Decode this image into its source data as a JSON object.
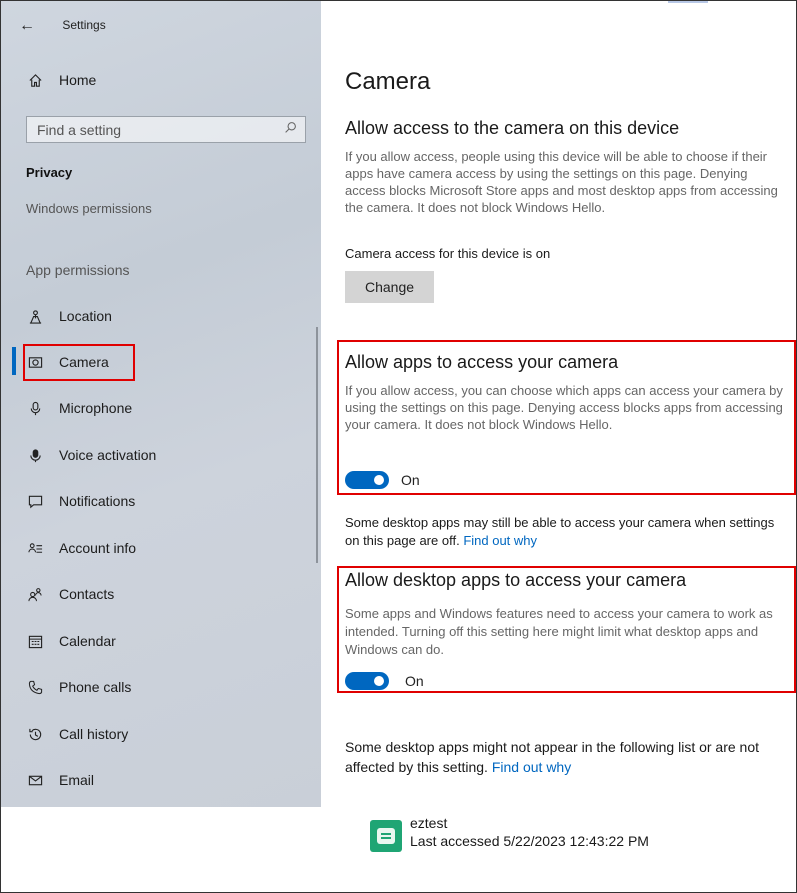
{
  "window": {
    "title": "Settings"
  },
  "sidebar": {
    "home_label": "Home",
    "search_placeholder": "Find a setting",
    "section": "Privacy",
    "faded_item": "Windows permissions",
    "group_label": "App permissions",
    "items": [
      {
        "label": "Location",
        "icon": "location-icon"
      },
      {
        "label": "Camera",
        "icon": "camera-icon",
        "selected": true
      },
      {
        "label": "Microphone",
        "icon": "microphone-icon"
      },
      {
        "label": "Voice activation",
        "icon": "voice-activation-icon"
      },
      {
        "label": "Notifications",
        "icon": "notifications-icon"
      },
      {
        "label": "Account info",
        "icon": "account-info-icon"
      },
      {
        "label": "Contacts",
        "icon": "contacts-icon"
      },
      {
        "label": "Calendar",
        "icon": "calendar-icon"
      },
      {
        "label": "Phone calls",
        "icon": "phone-icon"
      },
      {
        "label": "Call history",
        "icon": "history-icon"
      },
      {
        "label": "Email",
        "icon": "email-icon"
      }
    ]
  },
  "main": {
    "page_title": "Camera",
    "device_section": {
      "heading": "Allow access to the camera on this device",
      "description": "If you allow access, people using this device will be able to choose if their apps have camera access by using the settings on this page. Denying access blocks Microsoft Store apps and most desktop apps from accessing the camera. It does not block Windows Hello.",
      "status": "Camera access for this device is on",
      "button": "Change"
    },
    "apps_section": {
      "heading": "Allow apps to access your camera",
      "description": "If you allow access, you can choose which apps can access your camera by using the settings on this page. Denying access blocks apps from accessing your camera. It does not block Windows Hello.",
      "toggle_label": "On",
      "toggle_on": true
    },
    "note1": {
      "text": "Some desktop apps may still be able to access your camera when settings on this page are off.",
      "link": "Find out why"
    },
    "desktop_section": {
      "heading": "Allow desktop apps to access your camera",
      "description": "Some apps and Windows features need to access your camera to work as intended. Turning off this setting here might limit what desktop apps and Windows can do.",
      "toggle_label": "On",
      "toggle_on": true
    },
    "note2": {
      "text": "Some desktop apps might not appear in the following list or are not affected by this setting.",
      "link": "Find out why"
    },
    "app_list": [
      {
        "name": "eztest",
        "last_accessed": "Last accessed 5/22/2023 12:43:22 PM"
      }
    ]
  },
  "colors": {
    "accent": "#0067c0",
    "highlight": "#e00000"
  }
}
